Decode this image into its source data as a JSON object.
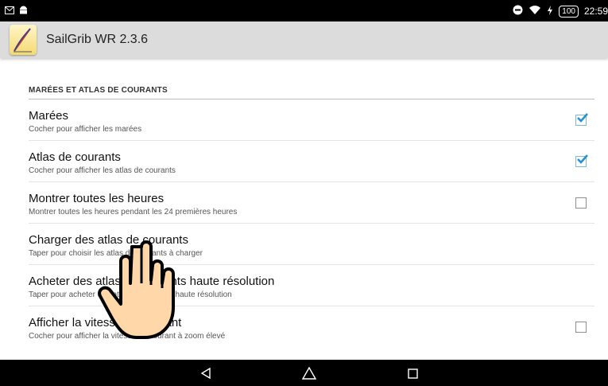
{
  "status_bar": {
    "battery": "100",
    "time": "22:59",
    "icons": [
      "mail-icon",
      "android-icon",
      "minus-circle-icon",
      "wifi-icon",
      "charging-icon"
    ]
  },
  "app_bar": {
    "title": "SailGrib WR 2.3.6",
    "icon": "sailgrib-app-icon"
  },
  "section": {
    "header": "MARÉES ET ATLAS DE COURANTS"
  },
  "preferences": [
    {
      "title": "Marées",
      "summary": "Cocher pour afficher les marées",
      "checkbox": true,
      "checked": true
    },
    {
      "title": "Atlas de courants",
      "summary": "Cocher pour afficher les atlas de courants",
      "checkbox": true,
      "checked": true
    },
    {
      "title": "Montrer toutes les heures",
      "summary": "Montrer toutes les heures pendant les 24 premières heures",
      "checkbox": true,
      "checked": false
    },
    {
      "title": "Charger des atlas de courants",
      "summary": "Taper pour choisir les atlas de courants à charger",
      "checkbox": false,
      "checked": false
    },
    {
      "title": "Acheter des atlas de courants haute résolution",
      "summary": "Taper pour acheter des atlas de courants haute résolution",
      "checkbox": false,
      "checked": false
    },
    {
      "title": "Afficher la vitesse du courant",
      "summary": "Cocher pour afficher la vitesse du courant à zoom élevé",
      "checkbox": true,
      "checked": false
    }
  ],
  "nav_bar": {
    "buttons": [
      "back-icon",
      "home-icon",
      "recents-icon"
    ]
  },
  "colors": {
    "status_bar": "#000000",
    "app_bar": "#dcdcdc",
    "checkbox_checked": "#2a8fcf",
    "hand_fill": "#ffd7a8"
  }
}
